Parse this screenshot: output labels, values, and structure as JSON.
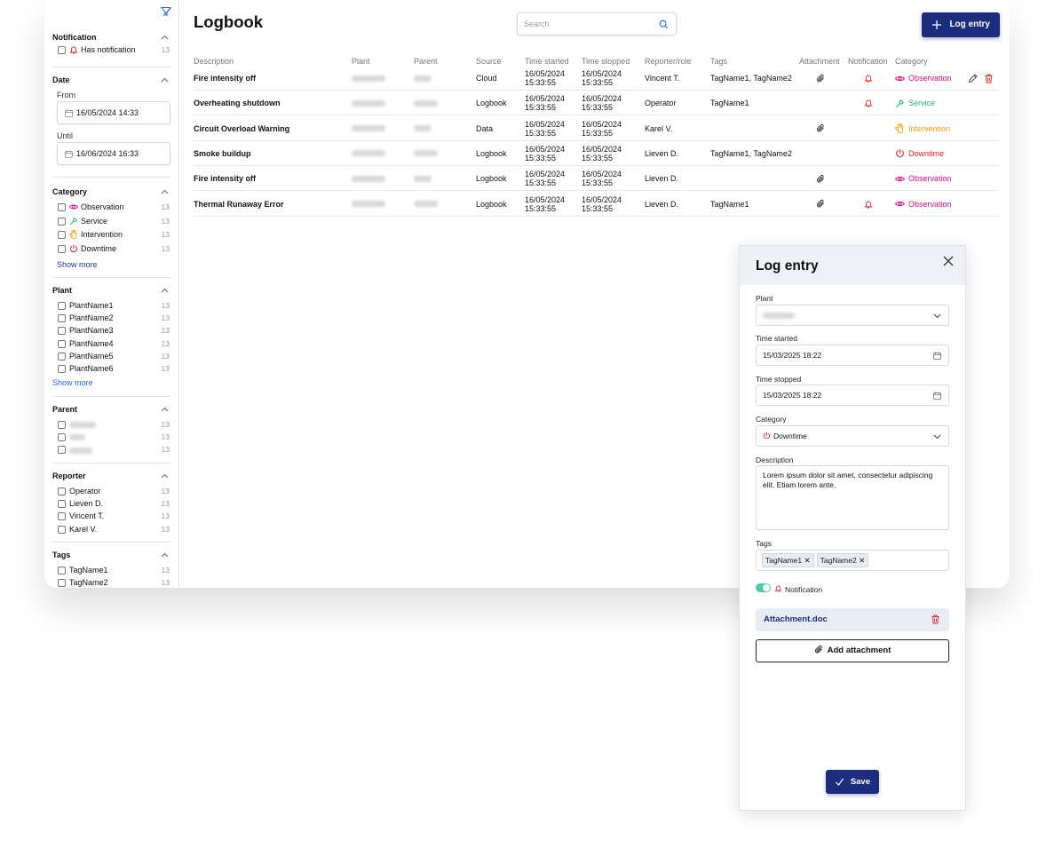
{
  "app": {
    "title": "Logbook",
    "search_placeholder": "Search",
    "log_entry_button": "Log entry"
  },
  "colors": {
    "primary": "#1c2d7d",
    "observation": "#d6107f",
    "service": "#2bb48c",
    "intervention": "#f59e0b",
    "downtime": "#e02424",
    "toggle": "#4cc9a5"
  },
  "sidebar": {
    "notification": {
      "title": "Notification",
      "items": [
        {
          "label": "Has notification",
          "count": "13",
          "icon": "bell-icon"
        }
      ]
    },
    "date": {
      "title": "Date",
      "from_label": "From",
      "from_value": "16/05/2024 14:33",
      "until_label": "Until",
      "until_value": "16/06/2024 16:33"
    },
    "category": {
      "title": "Category",
      "items": [
        {
          "label": "Observation",
          "count": "13",
          "icon": "eye-icon"
        },
        {
          "label": "Service",
          "count": "13",
          "icon": "wrench-icon"
        },
        {
          "label": "Intervention",
          "count": "13",
          "icon": "hand-icon"
        },
        {
          "label": "Downtime",
          "count": "13",
          "icon": "power-icon"
        }
      ],
      "show_more": "Show more"
    },
    "plant": {
      "title": "Plant",
      "items": [
        {
          "label": "PlantName1",
          "count": "13"
        },
        {
          "label": "PlantName2",
          "count": "13"
        },
        {
          "label": "PlantName3",
          "count": "13"
        },
        {
          "label": "PlantName4",
          "count": "13"
        },
        {
          "label": "PlantName5",
          "count": "13"
        },
        {
          "label": "PlantName6",
          "count": "13"
        }
      ],
      "show_more": "Show more"
    },
    "parent": {
      "title": "Parent",
      "items": [
        {
          "count": "13"
        },
        {
          "count": "13"
        },
        {
          "count": "13"
        }
      ]
    },
    "reporter": {
      "title": "Reporter",
      "items": [
        {
          "label": "Operator",
          "count": "13"
        },
        {
          "label": "Lieven D.",
          "count": "13"
        },
        {
          "label": "Vincent T.",
          "count": "13"
        },
        {
          "label": "Karel V.",
          "count": "13"
        }
      ]
    },
    "tags": {
      "title": "Tags",
      "items": [
        {
          "label": "TagName1",
          "count": "13"
        },
        {
          "label": "TagName2",
          "count": "13"
        }
      ]
    }
  },
  "table": {
    "columns": [
      "Description",
      "Plant",
      "Parent",
      "Source",
      "Time started",
      "Time stopped",
      "Reporter/role",
      "Tags",
      "Attachment",
      "Notification",
      "Category"
    ],
    "rows": [
      {
        "description": "Fire intensity off",
        "source": "Cloud",
        "started_date": "16/05/2024",
        "started_time": "15:33:55",
        "stopped_date": "16/05/2024",
        "stopped_time": "15:33:55",
        "reporter": "Vincent T.",
        "tags": "TagName1, TagName2",
        "attachment": true,
        "notification": true,
        "category": "Observation",
        "category_key": "observation",
        "actions": true
      },
      {
        "description": "Overheating shutdown",
        "source": "Logbook",
        "started_date": "16/05/2024",
        "started_time": "15:33:55",
        "stopped_date": "16/05/2024",
        "stopped_time": "15:33:55",
        "reporter": "Operator",
        "tags": "TagName1",
        "attachment": false,
        "notification": true,
        "category": "Service",
        "category_key": "service",
        "actions": false
      },
      {
        "description": "Circuit Overload Warning",
        "source": "Data",
        "started_date": "16/05/2024",
        "started_time": "15:33:55",
        "stopped_date": "16/05/2024",
        "stopped_time": "15:33:55",
        "reporter": "Karel V.",
        "tags": "",
        "attachment": true,
        "notification": false,
        "category": "Intervention",
        "category_key": "intervention",
        "actions": false
      },
      {
        "description": "Smoke buildup",
        "source": "Logbook",
        "started_date": "16/05/2024",
        "started_time": "15:33:55",
        "stopped_date": "16/05/2024",
        "stopped_time": "15:33:55",
        "reporter": "Lieven D.",
        "tags": "TagName1, TagName2",
        "attachment": false,
        "notification": false,
        "category": "Downtime",
        "category_key": "downtime",
        "actions": false
      },
      {
        "description": "Fire intensity off",
        "source": "Logbook",
        "started_date": "16/05/2024",
        "started_time": "15:33:55",
        "stopped_date": "16/05/2024",
        "stopped_time": "15:33:55",
        "reporter": "Lieven D.",
        "tags": "",
        "attachment": true,
        "notification": false,
        "category": "Observation",
        "category_key": "observation",
        "actions": false
      },
      {
        "description": "Thermal Runaway Error",
        "source": "Logbook",
        "started_date": "16/05/2024",
        "started_time": "15:33:55",
        "stopped_date": "16/05/2024",
        "stopped_time": "15:33:55",
        "reporter": "Lieven D.",
        "tags": "TagName1",
        "attachment": true,
        "notification": true,
        "category": "Observation",
        "category_key": "observation",
        "actions": false
      }
    ]
  },
  "panel": {
    "title": "Log entry",
    "plant_label": "Plant",
    "time_started_label": "Time started",
    "time_started_value": "15/03/2025 18:22",
    "time_stopped_label": "Time stopped",
    "time_stopped_value": "15/03/2025 18:22",
    "category_label": "Category",
    "category_value": "Downtime",
    "description_label": "Description",
    "description_value": "Lorem ipsum dolor sit amet, consectetur adipiscing elit. Etiam lorem ante,",
    "tags_label": "Tags",
    "tags": [
      "TagName1",
      "TagName2"
    ],
    "notification_label": "Notification",
    "attachment_name": "Attachment.doc",
    "add_attachment_label": "Add attachment",
    "save_label": "Save"
  }
}
